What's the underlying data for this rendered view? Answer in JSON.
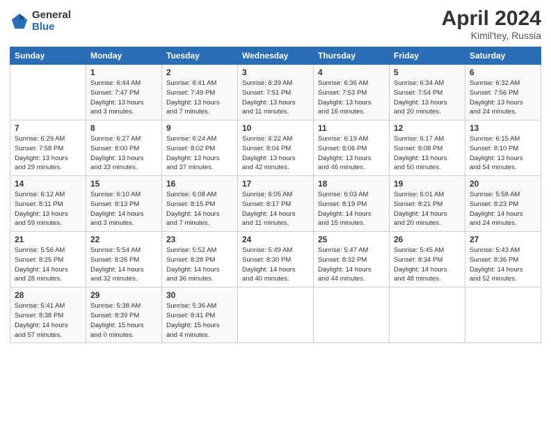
{
  "header": {
    "logo_general": "General",
    "logo_blue": "Blue",
    "month_title": "April 2024",
    "location": "Kimil'tey, Russia"
  },
  "days_of_week": [
    "Sunday",
    "Monday",
    "Tuesday",
    "Wednesday",
    "Thursday",
    "Friday",
    "Saturday"
  ],
  "weeks": [
    [
      {
        "day": "",
        "info": ""
      },
      {
        "day": "1",
        "info": "Sunrise: 6:44 AM\nSunset: 7:47 PM\nDaylight: 13 hours\nand 3 minutes."
      },
      {
        "day": "2",
        "info": "Sunrise: 6:41 AM\nSunset: 7:49 PM\nDaylight: 13 hours\nand 7 minutes."
      },
      {
        "day": "3",
        "info": "Sunrise: 6:39 AM\nSunset: 7:51 PM\nDaylight: 13 hours\nand 11 minutes."
      },
      {
        "day": "4",
        "info": "Sunrise: 6:36 AM\nSunset: 7:53 PM\nDaylight: 13 hours\nand 16 minutes."
      },
      {
        "day": "5",
        "info": "Sunrise: 6:34 AM\nSunset: 7:54 PM\nDaylight: 13 hours\nand 20 minutes."
      },
      {
        "day": "6",
        "info": "Sunrise: 6:32 AM\nSunset: 7:56 PM\nDaylight: 13 hours\nand 24 minutes."
      }
    ],
    [
      {
        "day": "7",
        "info": "Sunrise: 6:29 AM\nSunset: 7:58 PM\nDaylight: 13 hours\nand 29 minutes."
      },
      {
        "day": "8",
        "info": "Sunrise: 6:27 AM\nSunset: 8:00 PM\nDaylight: 13 hours\nand 33 minutes."
      },
      {
        "day": "9",
        "info": "Sunrise: 6:24 AM\nSunset: 8:02 PM\nDaylight: 13 hours\nand 37 minutes."
      },
      {
        "day": "10",
        "info": "Sunrise: 6:22 AM\nSunset: 8:04 PM\nDaylight: 13 hours\nand 42 minutes."
      },
      {
        "day": "11",
        "info": "Sunrise: 6:19 AM\nSunset: 8:06 PM\nDaylight: 13 hours\nand 46 minutes."
      },
      {
        "day": "12",
        "info": "Sunrise: 6:17 AM\nSunset: 8:08 PM\nDaylight: 13 hours\nand 50 minutes."
      },
      {
        "day": "13",
        "info": "Sunrise: 6:15 AM\nSunset: 8:10 PM\nDaylight: 13 hours\nand 54 minutes."
      }
    ],
    [
      {
        "day": "14",
        "info": "Sunrise: 6:12 AM\nSunset: 8:11 PM\nDaylight: 13 hours\nand 59 minutes."
      },
      {
        "day": "15",
        "info": "Sunrise: 6:10 AM\nSunset: 8:13 PM\nDaylight: 14 hours\nand 3 minutes."
      },
      {
        "day": "16",
        "info": "Sunrise: 6:08 AM\nSunset: 8:15 PM\nDaylight: 14 hours\nand 7 minutes."
      },
      {
        "day": "17",
        "info": "Sunrise: 6:05 AM\nSunset: 8:17 PM\nDaylight: 14 hours\nand 11 minutes."
      },
      {
        "day": "18",
        "info": "Sunrise: 6:03 AM\nSunset: 8:19 PM\nDaylight: 14 hours\nand 15 minutes."
      },
      {
        "day": "19",
        "info": "Sunrise: 6:01 AM\nSunset: 8:21 PM\nDaylight: 14 hours\nand 20 minutes."
      },
      {
        "day": "20",
        "info": "Sunrise: 5:58 AM\nSunset: 8:23 PM\nDaylight: 14 hours\nand 24 minutes."
      }
    ],
    [
      {
        "day": "21",
        "info": "Sunrise: 5:56 AM\nSunset: 8:25 PM\nDaylight: 14 hours\nand 28 minutes."
      },
      {
        "day": "22",
        "info": "Sunrise: 5:54 AM\nSunset: 8:26 PM\nDaylight: 14 hours\nand 32 minutes."
      },
      {
        "day": "23",
        "info": "Sunrise: 5:52 AM\nSunset: 8:28 PM\nDaylight: 14 hours\nand 36 minutes."
      },
      {
        "day": "24",
        "info": "Sunrise: 5:49 AM\nSunset: 8:30 PM\nDaylight: 14 hours\nand 40 minutes."
      },
      {
        "day": "25",
        "info": "Sunrise: 5:47 AM\nSunset: 8:32 PM\nDaylight: 14 hours\nand 44 minutes."
      },
      {
        "day": "26",
        "info": "Sunrise: 5:45 AM\nSunset: 8:34 PM\nDaylight: 14 hours\nand 48 minutes."
      },
      {
        "day": "27",
        "info": "Sunrise: 5:43 AM\nSunset: 8:36 PM\nDaylight: 14 hours\nand 52 minutes."
      }
    ],
    [
      {
        "day": "28",
        "info": "Sunrise: 5:41 AM\nSunset: 8:38 PM\nDaylight: 14 hours\nand 57 minutes."
      },
      {
        "day": "29",
        "info": "Sunrise: 5:38 AM\nSunset: 8:39 PM\nDaylight: 15 hours\nand 0 minutes."
      },
      {
        "day": "30",
        "info": "Sunrise: 5:36 AM\nSunset: 8:41 PM\nDaylight: 15 hours\nand 4 minutes."
      },
      {
        "day": "",
        "info": ""
      },
      {
        "day": "",
        "info": ""
      },
      {
        "day": "",
        "info": ""
      },
      {
        "day": "",
        "info": ""
      }
    ]
  ]
}
